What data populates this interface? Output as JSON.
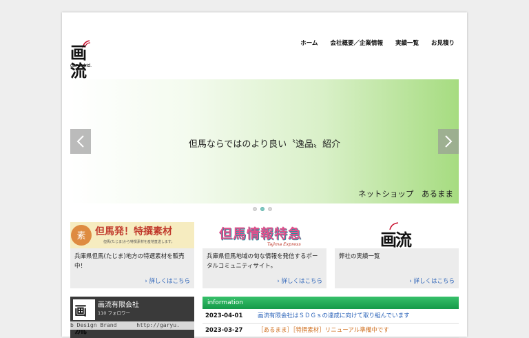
{
  "brand": {
    "logo_mark": "画流",
    "logo_sub": "garyu Ltd."
  },
  "nav": [
    {
      "label": "ホーム"
    },
    {
      "label": "会社概要／企業情報"
    },
    {
      "label": "実績一覧"
    },
    {
      "label": "お見積り"
    }
  ],
  "slider": {
    "title": "但馬ならではのより良い〝逸品〟紹介",
    "caption": "ネットショップ　あるまま",
    "dots": 3,
    "active_dot": 1
  },
  "cards": [
    {
      "banner_title": "但馬発！特撰素材",
      "banner_sub": "但馬(たじま)から特撰素材を産地直送します。",
      "text": "兵庫県但馬(たじま)地方の特選素材を販売中！",
      "link": "詳しくはこちら"
    },
    {
      "banner_title": "但馬情報特急",
      "banner_sub": "Tajima Express",
      "text": "兵庫県但馬地域の旬な情報を発信するポータルコミュニティサイト。",
      "link": "詳しくはこちら"
    },
    {
      "banner_title": "画流",
      "text": "弊社の実績一覧",
      "link": "詳しくはこちら"
    }
  ],
  "facebook": {
    "name": "画流有限会社",
    "followers": "110 フォロワー",
    "strip_left": "b Design Brand",
    "strip_right": "http://garyu."
  },
  "info": {
    "heading": "information",
    "rows": [
      {
        "date": "2023-04-01",
        "title": "画流有限会社はＳＤＧｓの達成に向けて取り組んでいます"
      },
      {
        "date": "2023-03-27",
        "title": "［あるまま］［特撰素材］リニューアル準備中です"
      }
    ]
  },
  "colors": {
    "accent_green": "#159a49",
    "link_blue": "#2a62b8",
    "logo_red": "#c8102e"
  }
}
